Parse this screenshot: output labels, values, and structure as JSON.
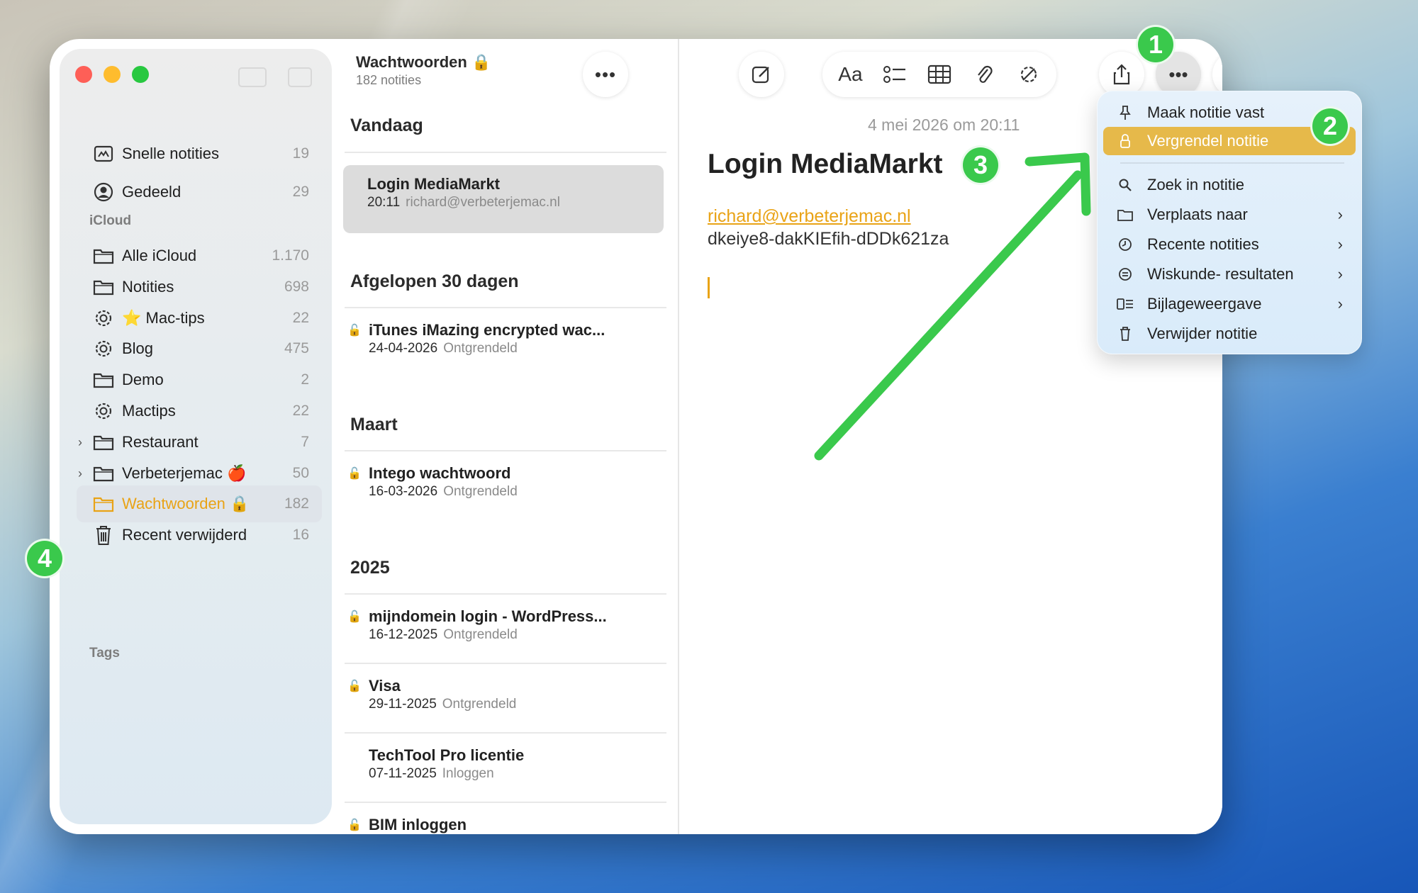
{
  "sidebar": {
    "pinned": [
      {
        "label": "Snelle notities",
        "count": "19",
        "icon": "quick-note-icon"
      },
      {
        "label": "Gedeeld",
        "count": "29",
        "icon": "shared-person-icon"
      }
    ],
    "icloud_header": "iCloud",
    "folders": [
      {
        "label": "Alle iCloud",
        "count": "1.170",
        "icon": "folder-icon"
      },
      {
        "label": "Notities",
        "count": "698",
        "icon": "folder-icon"
      },
      {
        "label": "⭐ Mac-tips",
        "count": "22",
        "icon": "gear-icon"
      },
      {
        "label": "Blog",
        "count": "475",
        "icon": "gear-icon"
      },
      {
        "label": "Demo",
        "count": "2",
        "icon": "folder-icon"
      },
      {
        "label": "Mactips",
        "count": "22",
        "icon": "gear-icon"
      },
      {
        "label": "Restaurant",
        "count": "7",
        "icon": "folder-icon"
      },
      {
        "label": "Verbeterjemac 🍎",
        "count": "50",
        "icon": "folder-icon"
      },
      {
        "label": "Wachtwoorden 🔒",
        "count": "182",
        "icon": "folder-icon"
      },
      {
        "label": "Recent verwijderd",
        "count": "16",
        "icon": "trash-icon"
      }
    ],
    "tags_header": "Tags"
  },
  "list": {
    "folder_title": "Wachtwoorden 🔒",
    "folder_subtitle": "182 notities",
    "sections": {
      "today": "Vandaag",
      "last30": "Afgelopen 30 dagen",
      "march": "Maart",
      "y2025": "2025"
    },
    "notes": [
      {
        "title": "Login MediaMarkt",
        "time": "20:11",
        "detail": "richard@verbeterjemac.nl",
        "locked": false
      },
      {
        "title": "iTunes iMazing encrypted wac...",
        "time": "24-04-2026",
        "detail": "Ontgrendeld",
        "locked": true
      },
      {
        "title": "Intego wachtwoord",
        "time": "16-03-2026",
        "detail": "Ontgrendeld",
        "locked": true
      },
      {
        "title": "mijndomein login - WordPress...",
        "time": "16-12-2025",
        "detail": "Ontgrendeld",
        "locked": true
      },
      {
        "title": "Visa",
        "time": "29-11-2025",
        "detail": "Ontgrendeld",
        "locked": true
      },
      {
        "title": "TechTool Pro licentie",
        "time": "07-11-2025",
        "detail": "Inloggen",
        "locked": false
      },
      {
        "title": "BIM inloggen",
        "time": "",
        "detail": "",
        "locked": true
      }
    ]
  },
  "editor": {
    "date": "4 mei 2026 om 20:11",
    "title": "Login MediaMarkt",
    "email": "richard@verbeterjemac.nl",
    "password": "dkeiye8-dakKIEfih-dDDk621za",
    "format_label": "Aa"
  },
  "menu": {
    "items": [
      {
        "label": "Maak notitie vast",
        "icon": "pin-icon",
        "submenu": false
      },
      {
        "label": "Vergrendel notitie",
        "icon": "lock-icon",
        "submenu": false,
        "highlighted": true
      },
      {
        "label": "Zoek in notitie",
        "icon": "search-icon",
        "submenu": false
      },
      {
        "label": "Verplaats naar",
        "icon": "folder-icon",
        "submenu": true
      },
      {
        "label": "Recente notities",
        "icon": "clock-icon",
        "submenu": true
      },
      {
        "label": "Wiskunde- resultaten",
        "icon": "equals-icon",
        "submenu": true
      },
      {
        "label": "Bijlageweergave",
        "icon": "attachment-view-icon",
        "submenu": true
      },
      {
        "label": "Verwijder notitie",
        "icon": "trash-icon",
        "submenu": false
      }
    ],
    "highlight_color": "#e6b94a"
  },
  "annotations": {
    "badges": [
      "1",
      "2",
      "3",
      "4"
    ],
    "color": "#3ac94c"
  },
  "accent_color": "#e9a316"
}
